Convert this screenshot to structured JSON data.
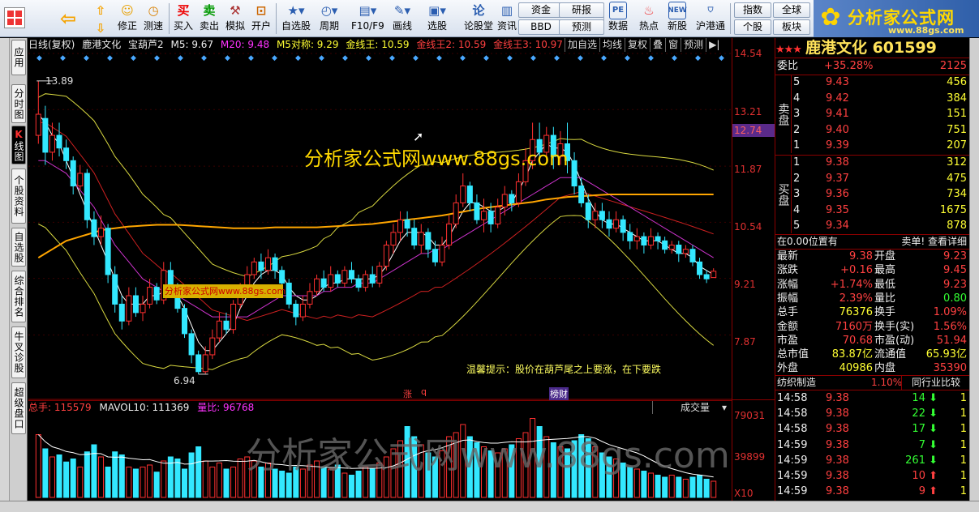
{
  "toolbar": {
    "buttons_a": [
      "修正",
      "测速",
      "买入",
      "卖出",
      "模拟",
      "开户"
    ],
    "buttons_b": [
      "自选股",
      "周期",
      "F10/F9",
      "画线",
      "选股",
      "论股堂",
      "资讯",
      "数据",
      "热点",
      "新股",
      "沪港通"
    ],
    "small_buttons": [
      "资金",
      "研报",
      "BBD",
      "预测",
      "指数",
      "全球",
      "个股",
      "板块"
    ],
    "logo_title": "分析家公式网",
    "logo_url": "www.88gs.com"
  },
  "left_nav": [
    "应用",
    "分时图",
    "K线图",
    "个股资料",
    "自选股",
    "综合排名",
    "牛叉诊股",
    "超级盘口"
  ],
  "chart_header": {
    "period": "日线(复权)",
    "stock": "鹿港文化",
    "indicator": "宝葫芦2",
    "m5": "M5: 9.67",
    "m20": "M20: 9.48",
    "m5dc": "M5对称: 9.29",
    "jx1": "金线王: 10.59",
    "jx2": "金线王2: 10.59",
    "jx3": "金线王3: 10.97",
    "tabs": [
      "加自选",
      "均线",
      "复权",
      "叠",
      "窗",
      "预测",
      "▶|"
    ]
  },
  "chart_overlay": {
    "watermark1": "分析家公式网www.88gs.com",
    "watermark2": "分析家公式网www.88gs.com",
    "hint": "温馨提示：股价在葫芦尾之上要涨，在下要跌",
    "high_label": "13.89",
    "low_label": "6.94",
    "zhang": "涨",
    "q": "q",
    "bang": "榜财",
    "current_price_tag": "12.74"
  },
  "price_axis": [
    "14.54",
    "13.21",
    "11.87",
    "10.54",
    "9.21",
    "7.87"
  ],
  "volume": {
    "label": "总手: 115579",
    "mavol": "MAVOL10: 111369",
    "liangbi": "量比: 96768",
    "selector": "成交量",
    "axis": [
      "79031",
      "39899",
      "X10"
    ],
    "watermark": "分析家公式网www.88gs.com"
  },
  "quote": {
    "title": "鹿港文化 601599",
    "weibi_label": "委比",
    "weibi": "+35.28%",
    "weicha": "2125",
    "sell_label": "卖盘",
    "buy_label": "买盘",
    "sell": [
      [
        "5",
        "9.43",
        "456"
      ],
      [
        "4",
        "9.42",
        "384"
      ],
      [
        "3",
        "9.41",
        "151"
      ],
      [
        "2",
        "9.40",
        "751"
      ],
      [
        "1",
        "9.39",
        "207"
      ]
    ],
    "buy": [
      [
        "1",
        "9.38",
        "312"
      ],
      [
        "2",
        "9.37",
        "475"
      ],
      [
        "3",
        "9.36",
        "734"
      ],
      [
        "4",
        "9.35",
        "1675"
      ],
      [
        "5",
        "9.34",
        "878"
      ]
    ],
    "position_text": "在0.00位置有",
    "sell_single": "卖单! 查看详细",
    "stats": [
      [
        "最新",
        "9.38",
        "开盘",
        "9.23"
      ],
      [
        "涨跌",
        "+0.16",
        "最高",
        "9.45"
      ],
      [
        "涨幅",
        "+1.74%",
        "最低",
        "9.23"
      ],
      [
        "振幅",
        "2.39%",
        "量比",
        "0.80"
      ],
      [
        "总手",
        "76376",
        "换手",
        "1.09%"
      ],
      [
        "金额",
        "7160万",
        "换手(实)",
        "1.56%"
      ],
      [
        "市盈",
        "70.68",
        "市盈(动)",
        "51.94"
      ],
      [
        "总市值",
        "83.87亿",
        "流通值",
        "65.93亿"
      ],
      [
        "外盘",
        "40986",
        "内盘",
        "35390"
      ]
    ],
    "industry": "纺织制造",
    "industry_pct": "1.10%",
    "industry_cmp": "同行业比较",
    "ticks": [
      [
        "14:58",
        "9.38",
        "14",
        "1",
        "down"
      ],
      [
        "14:58",
        "9.38",
        "22",
        "1",
        "down"
      ],
      [
        "14:58",
        "9.38",
        "17",
        "1",
        "down"
      ],
      [
        "14:59",
        "9.38",
        "7",
        "1",
        "down"
      ],
      [
        "14:59",
        "9.38",
        "261",
        "1",
        "down"
      ],
      [
        "14:59",
        "9.38",
        "10",
        "1",
        "up"
      ],
      [
        "14:59",
        "9.38",
        "9",
        "1",
        "up"
      ]
    ]
  },
  "chart_data": {
    "type": "candlestick",
    "title": "鹿港文化 日线(复权)",
    "ylim": [
      6.9,
      14.54
    ],
    "price_ticks": [
      14.54,
      13.21,
      11.87,
      10.54,
      9.21,
      7.87
    ],
    "candles": [
      [
        12.6,
        13.1,
        12.4,
        13.89
      ],
      [
        13.0,
        12.2,
        11.9,
        13.3
      ],
      [
        12.2,
        12.6,
        12.0,
        12.9
      ],
      [
        12.6,
        12.3,
        12.1,
        12.9
      ],
      [
        12.3,
        12.0,
        11.8,
        12.5
      ],
      [
        12.0,
        11.4,
        11.2,
        12.1
      ],
      [
        11.4,
        11.7,
        11.3,
        11.9
      ],
      [
        11.7,
        10.6,
        10.4,
        11.8
      ],
      [
        10.6,
        10.2,
        10.0,
        10.8
      ],
      [
        10.2,
        10.4,
        10.0,
        10.7
      ],
      [
        10.4,
        9.3,
        9.1,
        10.5
      ],
      [
        9.3,
        8.6,
        8.4,
        9.5
      ],
      [
        8.6,
        8.2,
        8.0,
        8.8
      ],
      [
        8.2,
        8.8,
        8.1,
        9.0
      ],
      [
        8.8,
        8.4,
        8.3,
        9.0
      ],
      [
        8.4,
        8.6,
        8.2,
        8.8
      ],
      [
        8.6,
        9.0,
        8.5,
        9.2
      ],
      [
        9.0,
        8.7,
        8.6,
        9.1
      ],
      [
        8.7,
        9.4,
        8.6,
        9.6
      ],
      [
        9.4,
        9.0,
        8.9,
        9.6
      ],
      [
        9.0,
        8.5,
        8.4,
        9.1
      ],
      [
        8.5,
        7.9,
        7.8,
        8.6
      ],
      [
        7.9,
        7.4,
        7.2,
        8.0
      ],
      [
        7.4,
        7.0,
        6.94,
        7.5
      ],
      [
        7.0,
        7.4,
        6.95,
        7.6
      ],
      [
        7.4,
        7.8,
        7.3,
        8.0
      ],
      [
        7.8,
        8.2,
        7.7,
        8.4
      ],
      [
        8.2,
        8.0,
        7.9,
        8.4
      ],
      [
        8.0,
        8.6,
        7.9,
        8.7
      ],
      [
        8.6,
        8.9,
        8.5,
        9.1
      ],
      [
        8.9,
        9.3,
        8.8,
        9.5
      ],
      [
        9.3,
        9.6,
        9.2,
        9.7
      ],
      [
        9.6,
        9.4,
        9.2,
        9.8
      ],
      [
        9.4,
        9.7,
        9.3,
        9.9
      ],
      [
        9.7,
        9.4,
        9.2,
        9.8
      ],
      [
        9.4,
        9.1,
        8.9,
        9.5
      ],
      [
        9.1,
        8.6,
        8.5,
        9.2
      ],
      [
        8.6,
        8.3,
        8.1,
        8.7
      ],
      [
        8.3,
        8.6,
        8.2,
        8.8
      ],
      [
        8.6,
        8.9,
        8.5,
        9.1
      ],
      [
        8.9,
        9.2,
        8.8,
        9.3
      ],
      [
        9.2,
        9.0,
        8.9,
        9.4
      ],
      [
        9.0,
        9.3,
        8.9,
        9.5
      ],
      [
        9.3,
        9.1,
        9.0,
        9.4
      ],
      [
        9.1,
        9.4,
        9.0,
        9.5
      ],
      [
        9.4,
        9.2,
        9.1,
        9.6
      ],
      [
        9.2,
        9.0,
        8.9,
        9.3
      ],
      [
        9.0,
        9.3,
        8.9,
        9.4
      ],
      [
        9.3,
        9.1,
        9.0,
        9.5
      ],
      [
        9.1,
        9.5,
        9.0,
        9.6
      ],
      [
        9.5,
        10.0,
        9.4,
        10.1
      ],
      [
        10.0,
        10.3,
        9.8,
        10.5
      ],
      [
        10.3,
        10.6,
        10.1,
        10.8
      ],
      [
        10.6,
        10.4,
        10.2,
        10.8
      ],
      [
        10.4,
        10.0,
        9.9,
        10.6
      ],
      [
        10.0,
        10.3,
        9.8,
        10.5
      ],
      [
        10.3,
        9.9,
        9.7,
        10.4
      ],
      [
        9.9,
        9.6,
        9.5,
        10.1
      ],
      [
        9.6,
        10.0,
        9.5,
        10.2
      ],
      [
        10.0,
        10.5,
        9.9,
        10.7
      ],
      [
        10.5,
        11.0,
        10.4,
        11.2
      ],
      [
        11.0,
        11.4,
        10.9,
        11.7
      ],
      [
        11.4,
        11.0,
        10.8,
        11.5
      ],
      [
        11.0,
        10.6,
        10.5,
        11.2
      ],
      [
        10.6,
        10.8,
        10.3,
        11.1
      ],
      [
        10.8,
        10.5,
        10.3,
        11.0
      ],
      [
        10.5,
        10.9,
        10.4,
        11.1
      ],
      [
        10.9,
        11.2,
        10.7,
        11.4
      ],
      [
        11.2,
        11.0,
        10.8,
        11.3
      ],
      [
        11.0,
        11.5,
        10.9,
        11.7
      ],
      [
        11.5,
        12.0,
        11.4,
        12.3
      ],
      [
        12.0,
        12.5,
        11.8,
        12.9
      ],
      [
        12.5,
        12.2,
        11.9,
        12.9
      ],
      [
        12.2,
        12.6,
        12.0,
        12.8
      ],
      [
        12.6,
        12.1,
        11.8,
        12.8
      ],
      [
        12.1,
        12.4,
        11.9,
        12.7
      ],
      [
        12.4,
        12.0,
        11.7,
        12.9
      ],
      [
        12.0,
        11.4,
        11.2,
        12.2
      ],
      [
        11.4,
        11.0,
        10.9,
        11.6
      ],
      [
        11.0,
        10.6,
        10.4,
        11.2
      ],
      [
        10.6,
        10.8,
        10.4,
        11.0
      ],
      [
        10.8,
        10.6,
        10.4,
        11.0
      ],
      [
        10.6,
        10.4,
        10.2,
        10.8
      ],
      [
        10.4,
        10.6,
        10.3,
        10.8
      ],
      [
        10.6,
        10.3,
        10.1,
        10.7
      ],
      [
        10.3,
        10.1,
        9.9,
        10.5
      ],
      [
        10.1,
        10.2,
        9.9,
        10.4
      ],
      [
        10.2,
        10.0,
        9.8,
        10.3
      ],
      [
        10.0,
        10.2,
        9.9,
        10.4
      ],
      [
        10.2,
        10.1,
        9.9,
        10.3
      ],
      [
        10.1,
        9.9,
        9.8,
        10.2
      ],
      [
        9.9,
        10.0,
        9.8,
        10.1
      ],
      [
        10.0,
        9.8,
        9.6,
        10.1
      ],
      [
        9.8,
        9.9,
        9.7,
        10.0
      ],
      [
        9.9,
        9.6,
        9.5,
        10.0
      ],
      [
        9.6,
        9.3,
        9.2,
        9.7
      ],
      [
        9.3,
        9.2,
        9.1,
        9.4
      ],
      [
        9.23,
        9.38,
        9.23,
        9.45
      ]
    ],
    "lines": [
      {
        "name": "M5",
        "color": "#ffffff",
        "values": [
          13.1,
          12.9,
          12.6,
          12.4,
          12.0,
          11.6,
          11.2,
          10.8,
          10.4,
          10.0,
          9.6,
          9.2,
          8.8,
          8.6,
          8.6,
          8.6,
          8.8,
          8.8,
          8.9,
          9.0,
          8.8,
          8.5,
          8.1,
          7.7,
          7.5,
          7.5,
          7.7,
          7.9,
          8.1,
          8.5,
          8.8,
          9.1,
          9.3,
          9.4,
          9.4,
          9.3,
          9.0,
          8.8,
          8.7,
          8.7,
          8.8,
          9.0,
          9.1,
          9.1,
          9.2,
          9.2,
          9.2,
          9.2,
          9.2,
          9.3,
          9.5,
          9.8,
          10.1,
          10.3,
          10.3,
          10.3,
          10.2,
          10.0,
          10.0,
          10.2,
          10.5,
          10.8,
          11.0,
          11.0,
          10.9,
          10.8,
          10.8,
          10.9,
          11.0,
          11.3,
          11.6,
          12.0,
          12.2,
          12.4,
          12.3,
          12.3,
          12.2,
          11.9,
          11.5,
          11.1,
          10.8,
          10.6,
          10.5,
          10.5,
          10.4,
          10.3,
          10.2,
          10.1,
          10.1,
          10.1,
          10.0,
          9.9,
          9.8,
          9.8,
          9.7,
          9.5,
          9.4,
          9.3
        ]
      },
      {
        "name": "M20",
        "color": "#cc33cc",
        "values": [
          12.0,
          12.0,
          11.9,
          11.8,
          11.7,
          11.5,
          11.3,
          11.1,
          10.9,
          10.6,
          10.3,
          10.0,
          9.8,
          9.6,
          9.4,
          9.2,
          9.1,
          9.0,
          8.9,
          8.9,
          8.8,
          8.7,
          8.6,
          8.5,
          8.4,
          8.3,
          8.3,
          8.3,
          8.3,
          8.3,
          8.3,
          8.4,
          8.5,
          8.6,
          8.7,
          8.8,
          8.8,
          8.8,
          8.8,
          8.8,
          8.8,
          8.9,
          8.9,
          9.0,
          9.0,
          9.0,
          9.1,
          9.1,
          9.1,
          9.2,
          9.3,
          9.4,
          9.5,
          9.6,
          9.7,
          9.8,
          9.8,
          9.9,
          9.9,
          10.0,
          10.1,
          10.2,
          10.3,
          10.4,
          10.5,
          10.6,
          10.7,
          10.8,
          10.9,
          11.0,
          11.1,
          11.2,
          11.3,
          11.4,
          11.5,
          11.6,
          11.6,
          11.6,
          11.6,
          11.5,
          11.4,
          11.3,
          11.2,
          11.1,
          11.0,
          10.9,
          10.8,
          10.7,
          10.6,
          10.5,
          10.4,
          10.3,
          10.2,
          10.1,
          10.0,
          9.9,
          9.8,
          9.7
        ]
      },
      {
        "name": "金线王",
        "color": "#ffa500",
        "values": [
          9.7,
          9.8,
          9.9,
          10.0,
          10.1,
          10.15,
          10.2,
          10.25,
          10.3,
          10.35,
          10.38,
          10.4,
          10.42,
          10.44,
          10.45,
          10.46,
          10.47,
          10.48,
          10.48,
          10.48,
          10.48,
          10.47,
          10.46,
          10.45,
          10.44,
          10.43,
          10.42,
          10.41,
          10.4,
          10.4,
          10.4,
          10.4,
          10.4,
          10.41,
          10.42,
          10.42,
          10.42,
          10.42,
          10.42,
          10.42,
          10.42,
          10.43,
          10.44,
          10.45,
          10.46,
          10.47,
          10.48,
          10.49,
          10.5,
          10.52,
          10.54,
          10.56,
          10.58,
          10.6,
          10.62,
          10.64,
          10.66,
          10.68,
          10.7,
          10.73,
          10.76,
          10.79,
          10.82,
          10.85,
          10.88,
          10.9,
          10.92,
          10.94,
          10.96,
          10.98,
          11.0,
          11.02,
          11.05,
          11.08,
          11.1,
          11.12,
          11.14,
          11.15,
          11.16,
          11.17,
          11.18,
          11.19,
          11.2,
          11.2,
          11.2,
          11.2,
          11.2,
          11.2,
          11.2,
          11.2,
          11.2,
          11.2,
          11.2,
          11.2,
          11.2,
          11.2,
          11.2,
          11.2
        ]
      }
    ],
    "volume": [
      62000,
      48000,
      40000,
      42000,
      35000,
      38000,
      30000,
      45000,
      52000,
      40000,
      30000,
      45000,
      42000,
      30000,
      28000,
      30000,
      32000,
      25000,
      36000,
      40000,
      38000,
      28000,
      44000,
      50000,
      36000,
      30000,
      34000,
      28000,
      30000,
      38000,
      40000,
      36000,
      30000,
      34000,
      28000,
      26000,
      24000,
      30000,
      28000,
      32000,
      36000,
      30000,
      28000,
      32000,
      24000,
      22000,
      26000,
      30000,
      28000,
      34000,
      40000,
      48000,
      56000,
      70000,
      60000,
      52000,
      44000,
      40000,
      46000,
      60000,
      64000,
      72000,
      60000,
      54000,
      50000,
      46000,
      44000,
      48000,
      52000,
      58000,
      64000,
      78000,
      70000,
      60000,
      54000,
      50000,
      48000,
      56000,
      62000,
      58000,
      50000,
      44000,
      40000,
      38000,
      34000,
      30000,
      28000,
      26000,
      24000,
      22000,
      20000,
      22000,
      20000,
      18000,
      20000,
      22000,
      18000,
      16000
    ]
  }
}
